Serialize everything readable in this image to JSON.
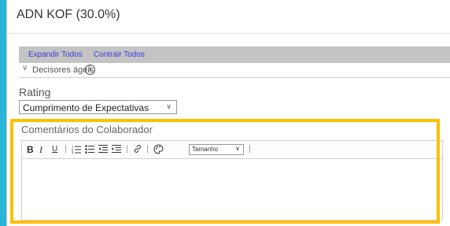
{
  "header": {
    "title": "ADN KOF (30.0%)"
  },
  "links": {
    "expand_all": "Expandir Todos",
    "collapse_all": "Contrair Todos"
  },
  "section": {
    "label": "Decisores ágeis",
    "chevron": "∨",
    "info_glyph": "i"
  },
  "rating": {
    "label": "Rating",
    "selected": "Cumprimento de Expectativas",
    "chevron": "∨"
  },
  "comments": {
    "label": "Comentários do Colaborador",
    "toolbar": {
      "bold": "B",
      "italic": "I",
      "underline": "U",
      "separator": "|",
      "font_size": "Tamanho",
      "chevron": "∨"
    },
    "value": ""
  },
  "colors": {
    "highlight": "#ffbf00",
    "background": "#29b6d6",
    "link": "#3b3bd6"
  }
}
